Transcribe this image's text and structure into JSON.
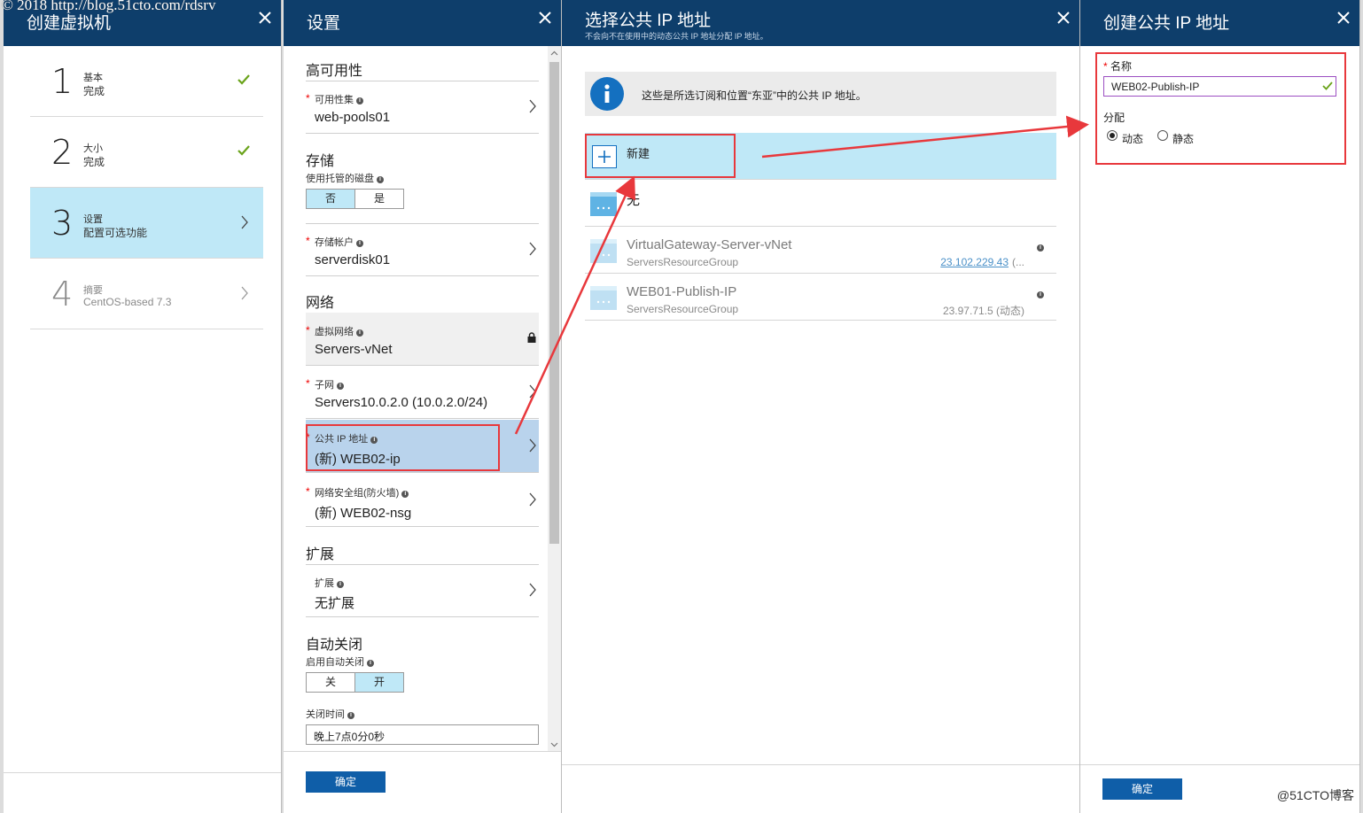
{
  "watermark": "© 2018 http://blog.51cto.com/rdsrv",
  "corner_mark": "@51CTO博客",
  "colors": {
    "header": "#0e3e6b",
    "accent": "#0f5ea8",
    "selected": "#bfe8f7",
    "highlight": "#e8383c",
    "check": "#6aa31a"
  },
  "blade1": {
    "title": "创建虚拟机",
    "steps": [
      {
        "num": "1",
        "title": "基本",
        "sub": "完成",
        "state": "done"
      },
      {
        "num": "2",
        "title": "大小",
        "sub": "完成",
        "state": "done"
      },
      {
        "num": "3",
        "title": "设置",
        "sub": "配置可选功能",
        "state": "active"
      },
      {
        "num": "4",
        "title": "摘要",
        "sub": "CentOS-based 7.3",
        "state": "disabled"
      }
    ]
  },
  "blade2": {
    "title": "设置",
    "sections": {
      "ha": "高可用性",
      "storage": "存储",
      "network": "网络",
      "extensions": "扩展",
      "autoshutdown": "自动关闭"
    },
    "availability_set": {
      "label": "可用性集",
      "value": "web-pools01"
    },
    "managed_disk": {
      "label": "使用托管的磁盘",
      "options": [
        "否",
        "是"
      ],
      "selected": "否"
    },
    "storage_account": {
      "label": "存储帐户",
      "value": "serverdisk01"
    },
    "vnet": {
      "label": "虚拟网络",
      "value": "Servers-vNet"
    },
    "subnet": {
      "label": "子网",
      "value": "Servers10.0.2.0 (10.0.2.0/24)"
    },
    "public_ip": {
      "label": "公共 IP 地址",
      "value": "(新) WEB02-ip"
    },
    "nsg": {
      "label": "网络安全组(防火墙)",
      "value": "(新) WEB02-nsg"
    },
    "extension": {
      "label": "扩展",
      "value": "无扩展"
    },
    "auto_shutdown": {
      "label": "启用自动关闭",
      "options": [
        "关",
        "开"
      ],
      "selected": "开"
    },
    "shutdown_time": {
      "label": "关闭时间",
      "value": "晚上7点0分0秒"
    },
    "ok": "确定"
  },
  "blade3": {
    "title": "选择公共 IP 地址",
    "subtitle": "不会向不在使用中的动态公共 IP 地址分配 IP 地址。",
    "info": "这些是所选订阅和位置“东亚”中的公共 IP 地址。",
    "new_label": "新建",
    "none_label": "无",
    "items": [
      {
        "name": "VirtualGateway-Server-vNet",
        "group": "ServersResourceGroup",
        "ip": "23.102.229.43",
        "suffix": "(..."
      },
      {
        "name": "WEB01-Publish-IP",
        "group": "ServersResourceGroup",
        "ip": "23.97.71.5 (动态)",
        "suffix": ""
      }
    ]
  },
  "blade4": {
    "title": "创建公共 IP 地址",
    "name_label": "名称",
    "name_value": "WEB02-Publish-IP",
    "assignment_label": "分配",
    "options": [
      "动态",
      "静态"
    ],
    "selected": "动态",
    "ok": "确定"
  }
}
